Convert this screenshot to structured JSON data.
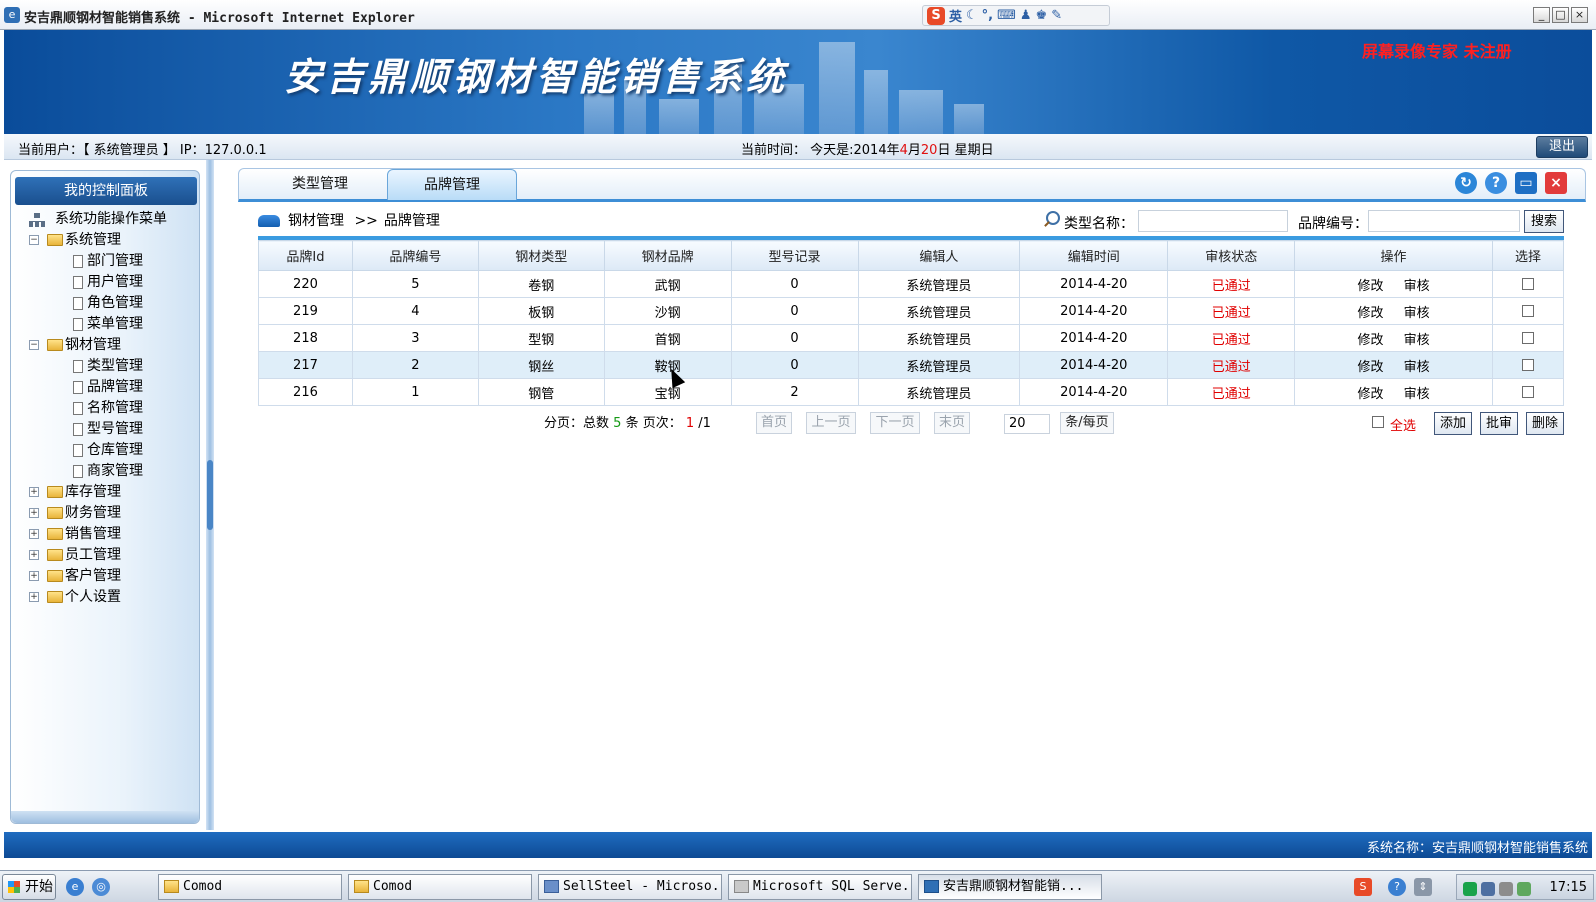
{
  "window": {
    "title": "安吉鼎顺钢材智能销售系统 - Microsoft Internet Explorer",
    "ime_label": "英",
    "buttons": [
      "_",
      "□",
      "×"
    ]
  },
  "banner": {
    "system_title": "安吉鼎顺钢材智能销售系统",
    "watermark": "屏幕录像专家 未注册"
  },
  "info": {
    "current_user": "当前用户：【 系统管理员 】 IP：127.0.0.1",
    "time_prefix": "当前时间：   今天是:2014年",
    "month": "4",
    "month_suffix": "月",
    "day": "20",
    "day_suffix": "日 星期日",
    "logout": "退出"
  },
  "sidebar": {
    "panel_title": "我的控制面板",
    "root": "系统功能操作菜单",
    "groups": [
      {
        "label": "系统管理",
        "expanded": true,
        "items": [
          "部门管理",
          "用户管理",
          "角色管理",
          "菜单管理"
        ]
      },
      {
        "label": "钢材管理",
        "expanded": true,
        "items": [
          "类型管理",
          "品牌管理",
          "名称管理",
          "型号管理",
          "仓库管理",
          "商家管理"
        ]
      },
      {
        "label": "库存管理",
        "expanded": false,
        "items": []
      },
      {
        "label": "财务管理",
        "expanded": false,
        "items": []
      },
      {
        "label": "销售管理",
        "expanded": false,
        "items": []
      },
      {
        "label": "员工管理",
        "expanded": false,
        "items": []
      },
      {
        "label": "客户管理",
        "expanded": false,
        "items": []
      },
      {
        "label": "个人设置",
        "expanded": false,
        "items": []
      }
    ]
  },
  "tabs": [
    {
      "label": "类型管理",
      "active": false
    },
    {
      "label": "品牌管理",
      "active": true
    }
  ],
  "breadcrumb": {
    "parent": "钢材管理",
    "separator": ">>",
    "current": "品牌管理"
  },
  "search": {
    "type_label": "类型名称：",
    "type_value": "",
    "brand_no_label": "品牌编号：",
    "brand_no_value": "",
    "button": "搜索"
  },
  "table": {
    "columns": [
      "品牌Id",
      "品牌编号",
      "钢材类型",
      "钢材品牌",
      "型号记录",
      "编辑人",
      "编辑时间",
      "审核状态",
      "操作",
      "选择"
    ],
    "rows": [
      {
        "id": "220",
        "no": "5",
        "type": "卷钢",
        "brand": "武钢",
        "models": "0",
        "editor": "系统管理员",
        "time": "2014-4-20",
        "status": "已通过",
        "op1": "修改",
        "op2": "审核"
      },
      {
        "id": "219",
        "no": "4",
        "type": "板钢",
        "brand": "沙钢",
        "models": "0",
        "editor": "系统管理员",
        "time": "2014-4-20",
        "status": "已通过",
        "op1": "修改",
        "op2": "审核"
      },
      {
        "id": "218",
        "no": "3",
        "type": "型钢",
        "brand": "首钢",
        "models": "0",
        "editor": "系统管理员",
        "time": "2014-4-20",
        "status": "已通过",
        "op1": "修改",
        "op2": "审核"
      },
      {
        "id": "217",
        "no": "2",
        "type": "钢丝",
        "brand": "鞍钢",
        "models": "0",
        "editor": "系统管理员",
        "time": "2014-4-20",
        "status": "已通过",
        "op1": "修改",
        "op2": "审核"
      },
      {
        "id": "216",
        "no": "1",
        "type": "钢管",
        "brand": "宝钢",
        "models": "2",
        "editor": "系统管理员",
        "time": "2014-4-20",
        "status": "已通过",
        "op1": "修改",
        "op2": "审核"
      }
    ]
  },
  "pager": {
    "prefix": "分页：总数",
    "total": "5",
    "unit": "条 页次：",
    "page": "1",
    "pages": "/1",
    "first": "首页",
    "prev": "上一页",
    "next": "下一页",
    "last": "末页",
    "page_size": "20",
    "per_page": "条/每页"
  },
  "actions": {
    "select_all": "全选",
    "add": "添加",
    "approve": "批审",
    "delete": "删除"
  },
  "statusbar": {
    "text": "系统名称：安吉鼎顺钢材智能销售系统"
  },
  "taskbar": {
    "start": "开始",
    "tasks": [
      "Comod",
      "Comod",
      "SellSteel - Microso...",
      "Microsoft SQL Serve...",
      "安吉鼎顺钢材智能销..."
    ],
    "clock": "17:15"
  },
  "colors": {
    "accent": "#3d8ed6",
    "status_ok": "#e00000",
    "banner": "#0a4c9a"
  }
}
